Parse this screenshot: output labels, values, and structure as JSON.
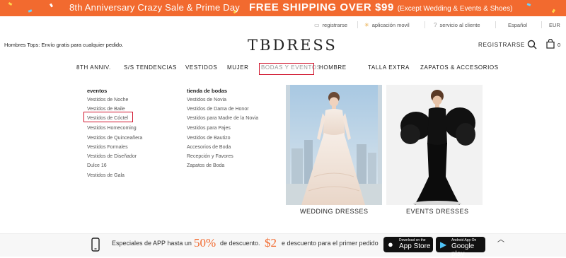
{
  "promo_bar": {
    "left_text": "8th Anniversary Crazy Sale & Prime Day",
    "right_text": "FREE SHIPPING OVER $99",
    "right_note": "(Except Wedding & Events & Shoes)",
    "bg_color": "#f26a2f"
  },
  "top_links": {
    "register": "registrarse",
    "app": "aplicación movil",
    "service": "servicio al cliente",
    "language": "Español",
    "currency": "EUR"
  },
  "header": {
    "shipping_note": "Hombres Tops: Envío gratis para cualquier pedido.",
    "logo": "TBDRESS",
    "register_button": "REGISTRARSE",
    "cart_count": "0"
  },
  "nav": {
    "items": [
      "8TH ANNIV.",
      "S/S TENDENCIAS",
      "VESTIDOS",
      "MUJER",
      "BODAS Y EVENTOS",
      "HOMBRE",
      "TALLA EXTRA",
      "ZAPATOS & ACCESORIOS"
    ],
    "active_index": 4
  },
  "dropdown": {
    "eventos": {
      "title": "eventos",
      "items": [
        "Vestidos de Noche",
        "Vestidos de Baile",
        "Vestidos de Cóctel",
        "Vestidos Homecoming",
        "Vestidos de Quinceañera",
        "Vestidos Formales",
        "Vestidos de Diseñador",
        "Dulce 16",
        "Vestidos de Gala"
      ],
      "highlight_index": 2
    },
    "tienda": {
      "title": "tienda de bodas",
      "items": [
        "Vestidos de Novia",
        "Vestidos de Dama de Honor",
        "Vestidos para Madre de la Novia",
        "Vestidos para Pajes",
        "Vestidos de Bautizo",
        "Accesorios de Boda",
        "Recepción y Favores",
        "Zapatos de Boda"
      ]
    },
    "promos": [
      {
        "caption": "WEDDING  DRESSES"
      },
      {
        "caption": "EVENTS DRESSES"
      }
    ]
  },
  "bottom_bar": {
    "text1": "Especiales de APP hasta un",
    "big1": "50%",
    "text2": "de descuento.",
    "big2": "$2",
    "text3": "e descuento para el primer pedido",
    "app_store_small": "Download on the",
    "app_store": "App Store",
    "google_small": "Android App On",
    "google": "Google play",
    "accent_color": "#f26a2f"
  }
}
